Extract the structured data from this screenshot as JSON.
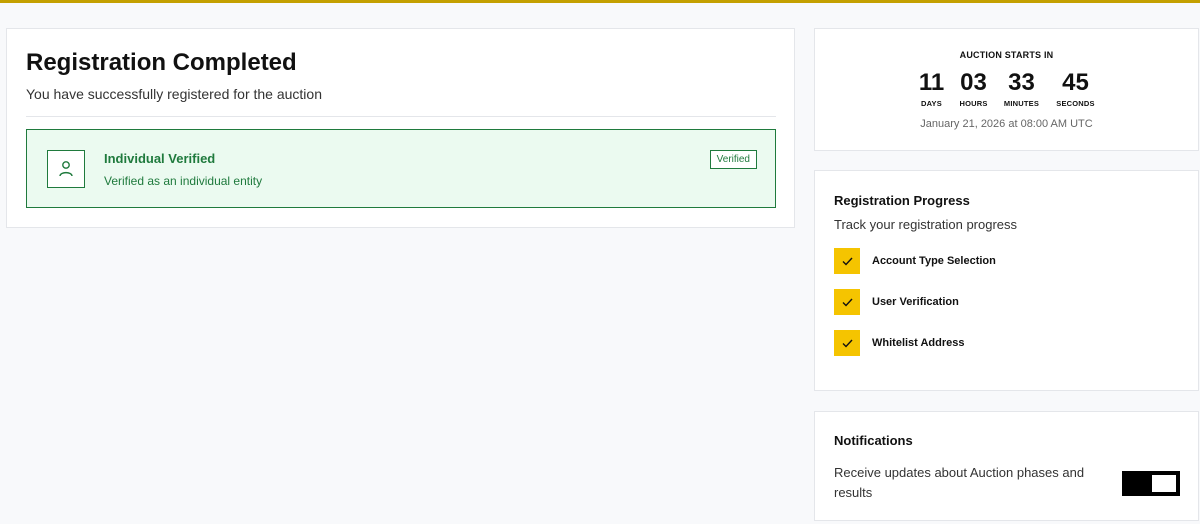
{
  "registration": {
    "title": "Registration Completed",
    "subtitle": "You have successfully registered for the auction",
    "verification": {
      "icon": "user-icon",
      "title": "Individual Verified",
      "description": "Verified as an individual entity",
      "badge": "Verified"
    }
  },
  "countdown": {
    "label": "AUCTION STARTS IN",
    "units": [
      {
        "value": "11",
        "name": "DAYS"
      },
      {
        "value": "03",
        "name": "HOURS"
      },
      {
        "value": "33",
        "name": "MINUTES"
      },
      {
        "value": "45",
        "name": "SECONDS"
      }
    ],
    "date": "January 21, 2026 at 08:00 AM UTC"
  },
  "progress": {
    "title": "Registration Progress",
    "subtitle": "Track your registration progress",
    "steps": [
      {
        "label": "Account Type Selection",
        "done": true
      },
      {
        "label": "User Verification",
        "done": true
      },
      {
        "label": "Whitelist Address",
        "done": true
      }
    ]
  },
  "notifications": {
    "title": "Notifications",
    "description": "Receive updates about Auction phases and results",
    "enabled": true
  },
  "colors": {
    "accent_yellow": "#f5c400",
    "success_green": "#1f7a3d",
    "top_bar": "#c4a000"
  }
}
